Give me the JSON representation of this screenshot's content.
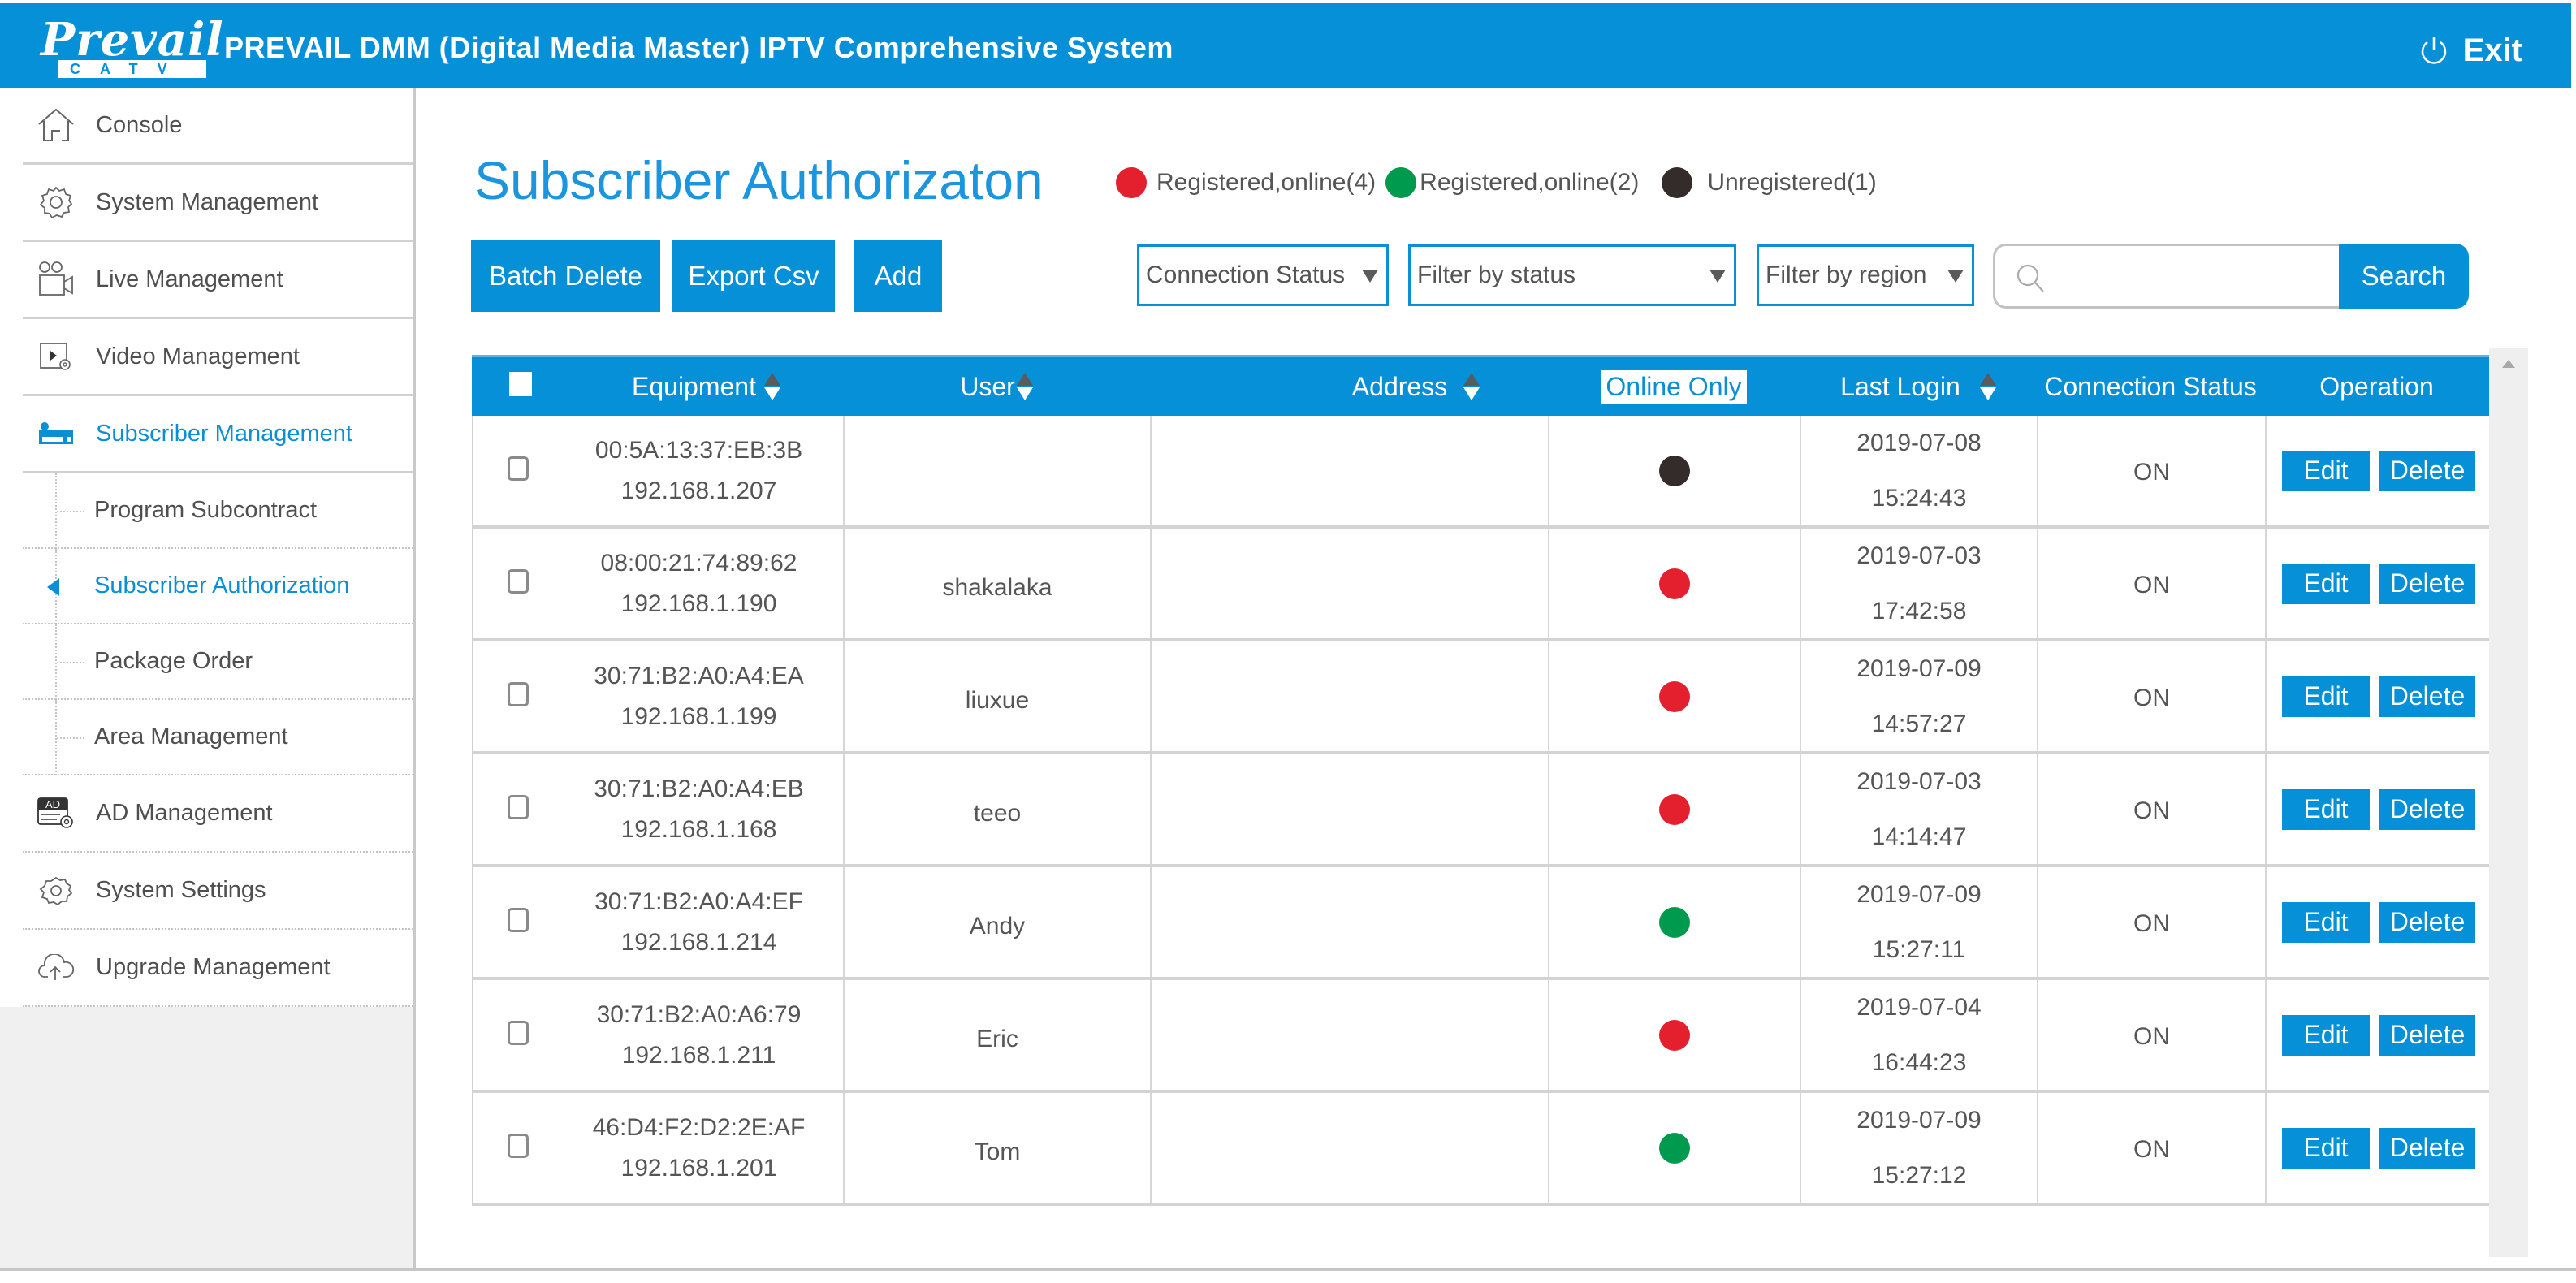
{
  "header": {
    "logo_word": "Prevail",
    "logo_sub": "CATV",
    "title": "PREVAIL DMM (Digital Media Master) IPTV Comprehensive System",
    "exit_label": "Exit",
    "exit_icon": "power-icon",
    "color": "#0590d8"
  },
  "sidebar": {
    "items": [
      {
        "label": "Console",
        "icon": "home-icon"
      },
      {
        "label": "System Management",
        "icon": "gear-icon"
      },
      {
        "label": "Live Management",
        "icon": "video-camera-icon"
      },
      {
        "label": "Video Management",
        "icon": "video-settings-icon"
      },
      {
        "label": "Subscriber Management",
        "icon": "set-top-box-icon",
        "active": true
      }
    ],
    "subitems": [
      {
        "label": "Program Subcontract"
      },
      {
        "label": "Subscriber Authorization",
        "active": true
      },
      {
        "label": "Package Order"
      },
      {
        "label": "Area Management"
      }
    ],
    "items_after": [
      {
        "label": "AD Management",
        "icon": "ad-icon"
      },
      {
        "label": "System Settings",
        "icon": "gear-icon"
      },
      {
        "label": "Upgrade Management",
        "icon": "cloud-upload-icon"
      }
    ]
  },
  "main": {
    "title": "Subscriber Authorizaton",
    "legend": [
      {
        "label": "Registered,online(4)",
        "color": "#e4202e"
      },
      {
        "label": "Registered,online(2)",
        "color": "#009a4e"
      },
      {
        "label": "Unregistered(1)",
        "color": "#332c2b"
      }
    ],
    "toolbar": {
      "batch_delete": "Batch Delete",
      "export_csv": "Export Csv",
      "add": "Add"
    },
    "filters": {
      "connection_status": "Connection Status",
      "filter_status": "Filter by status",
      "filter_region": "Filter by region"
    },
    "search": {
      "value": "",
      "placeholder": "",
      "button": "Search"
    },
    "table": {
      "columns": {
        "equipment": "Equipment",
        "user": "User",
        "address": "Address",
        "online_only": "Online Only",
        "last_login": "Last Login",
        "connection_status": "Connection Status",
        "operation": "Operation"
      },
      "edit_label": "Edit",
      "delete_label": "Delete",
      "rows": [
        {
          "mac": "00:5A:13:37:EB:3B",
          "ip": "192.168.1.207",
          "user": "",
          "address": "",
          "status": "unregistered",
          "date": "2019-07-08",
          "time": "15:24:43",
          "conn": "ON"
        },
        {
          "mac": "08:00:21:74:89:62",
          "ip": "192.168.1.190",
          "user": "shakalaka",
          "address": "",
          "status": "registered-red",
          "date": "2019-07-03",
          "time": "17:42:58",
          "conn": "ON"
        },
        {
          "mac": "30:71:B2:A0:A4:EA",
          "ip": "192.168.1.199",
          "user": "liuxue",
          "address": "",
          "status": "registered-red",
          "date": "2019-07-09",
          "time": "14:57:27",
          "conn": "ON"
        },
        {
          "mac": "30:71:B2:A0:A4:EB",
          "ip": "192.168.1.168",
          "user": "teeo",
          "address": "",
          "status": "registered-red",
          "date": "2019-07-03",
          "time": "14:14:47",
          "conn": "ON"
        },
        {
          "mac": "30:71:B2:A0:A4:EF",
          "ip": "192.168.1.214",
          "user": "Andy",
          "address": "",
          "status": "registered-green",
          "date": "2019-07-09",
          "time": "15:27:11",
          "conn": "ON"
        },
        {
          "mac": "30:71:B2:A0:A6:79",
          "ip": "192.168.1.211",
          "user": "Eric",
          "address": "",
          "status": "registered-red",
          "date": "2019-07-04",
          "time": "16:44:23",
          "conn": "ON"
        },
        {
          "mac": "46:D4:F2:D2:2E:AF",
          "ip": "192.168.1.201",
          "user": "Tom",
          "address": "",
          "status": "registered-green",
          "date": "2019-07-09",
          "time": "15:27:12",
          "conn": "ON"
        }
      ]
    },
    "status_colors": {
      "registered-red": "#e4202e",
      "registered-green": "#009a4e",
      "unregistered": "#332c2b"
    }
  }
}
